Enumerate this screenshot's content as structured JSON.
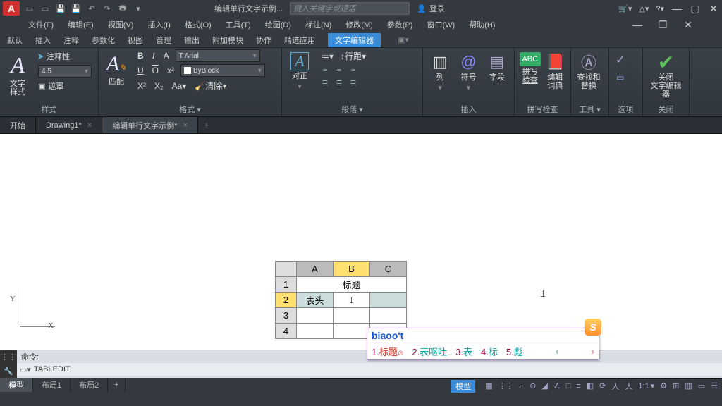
{
  "app": {
    "logo": "A",
    "title": "编辑单行文字示例...",
    "search_placeholder": "键入关键字或短语",
    "login_label": "登录"
  },
  "menus": [
    "文件(F)",
    "编辑(E)",
    "视图(V)",
    "插入(I)",
    "格式(O)",
    "工具(T)",
    "绘图(D)",
    "标注(N)",
    "修改(M)",
    "参数(P)",
    "窗口(W)",
    "帮助(H)"
  ],
  "ribbon_tabs": [
    "默认",
    "插入",
    "注释",
    "参数化",
    "视图",
    "管理",
    "输出",
    "附加模块",
    "协作",
    "精选应用",
    "文字编辑器"
  ],
  "active_ribbon_tab": 10,
  "groups": {
    "style": {
      "label": "样式",
      "opts": [
        "注释性",
        "4.5",
        "遮罩"
      ],
      "big_label": "文字\n样式"
    },
    "format": {
      "label": "格式",
      "match": "匹配",
      "font": "Arial",
      "color": "ByBlock",
      "clear": "清除"
    },
    "para": {
      "label": "段落",
      "align": "对正",
      "linespace": "行距"
    },
    "insert": {
      "label": "插入",
      "col": "列",
      "sym": "符号",
      "field": "字段"
    },
    "spell": {
      "label": "拼写检查",
      "spell_label": "拼写\n检查",
      "dict_label": "编辑\n词典",
      "abc": "ABC"
    },
    "tools": {
      "label": "工具",
      "find_label": "查找和\n替换"
    },
    "options": {
      "label": "选项"
    },
    "close": {
      "label": "关闭",
      "close_label": "关闭\n文字编辑器"
    }
  },
  "doc_tabs": [
    {
      "label": "开始",
      "closable": false
    },
    {
      "label": "Drawing1*",
      "closable": true
    },
    {
      "label": "编辑单行文字示例*",
      "closable": true,
      "active": true
    }
  ],
  "ucs": {
    "x": "X",
    "y": "Y"
  },
  "table": {
    "cols": [
      "A",
      "B",
      "C"
    ],
    "rows": [
      "1",
      "2",
      "3",
      "4"
    ],
    "title": "标题",
    "header_cell": "表头"
  },
  "ime": {
    "input": "biaoo't",
    "candidates": [
      {
        "n": "1.",
        "t": "标题"
      },
      {
        "n": "2.",
        "t": "表呕吐"
      },
      {
        "n": "3.",
        "t": "表"
      },
      {
        "n": "4.",
        "t": "标"
      },
      {
        "n": "5.",
        "t": "彪"
      }
    ],
    "logo": "S"
  },
  "cmd": {
    "prompt": "命令:",
    "history": "TABLEDIT"
  },
  "layout_tabs": [
    "模型",
    "布局1",
    "布局2"
  ],
  "status": {
    "model": "模型",
    "scale": "1:1"
  }
}
